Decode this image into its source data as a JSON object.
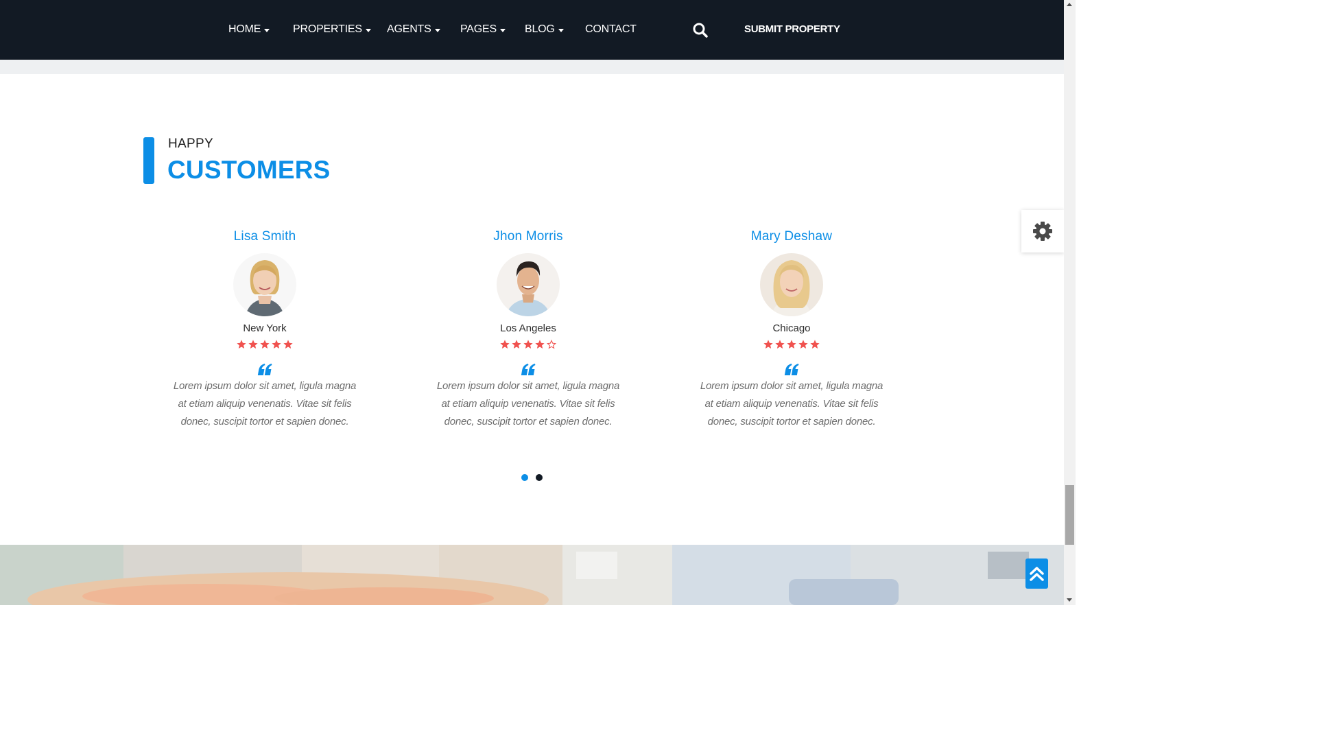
{
  "nav": {
    "items": [
      {
        "label": "HOME",
        "has_dropdown": true
      },
      {
        "label": "PROPERTIES",
        "has_dropdown": true
      },
      {
        "label": "AGENTS",
        "has_dropdown": true
      },
      {
        "label": "PAGES",
        "has_dropdown": true
      },
      {
        "label": "BLOG",
        "has_dropdown": true
      },
      {
        "label": "CONTACT",
        "has_dropdown": false
      }
    ],
    "search_icon": "search-icon",
    "submit_label": "SUBMIT PROPERTY"
  },
  "section": {
    "heading_small": "HAPPY",
    "heading_big": "CUSTOMERS"
  },
  "testimonials": [
    {
      "name": "Lisa Smith",
      "city": "New York",
      "rating": 5,
      "max_rating": 5,
      "text": "Lorem ipsum dolor sit amet, ligula magna at etiam aliquip venenatis. Vitae sit felis donec, suscipit tortor et sapien donec."
    },
    {
      "name": "Jhon Morris",
      "city": "Los Angeles",
      "rating": 4,
      "max_rating": 5,
      "text": "Lorem ipsum dolor sit amet, ligula magna at etiam aliquip venenatis. Vitae sit felis donec, suscipit tortor et sapien donec."
    },
    {
      "name": "Mary Deshaw",
      "city": "Chicago",
      "rating": 5,
      "max_rating": 5,
      "text": "Lorem ipsum dolor sit amet, ligula magna at etiam aliquip venenatis. Vitae sit felis donec, suscipit tortor et sapien donec."
    }
  ],
  "pagination": {
    "pages": 2,
    "active": 1
  },
  "colors": {
    "accent": "#0c8ee6",
    "nav_bg": "#121a24",
    "star": "#f0524f",
    "text_muted": "#6d6d6d"
  },
  "icons": {
    "settings": "gear-icon",
    "back_to_top": "double-chevron-up-icon",
    "quote": "quote-icon",
    "star": "star-icon"
  }
}
